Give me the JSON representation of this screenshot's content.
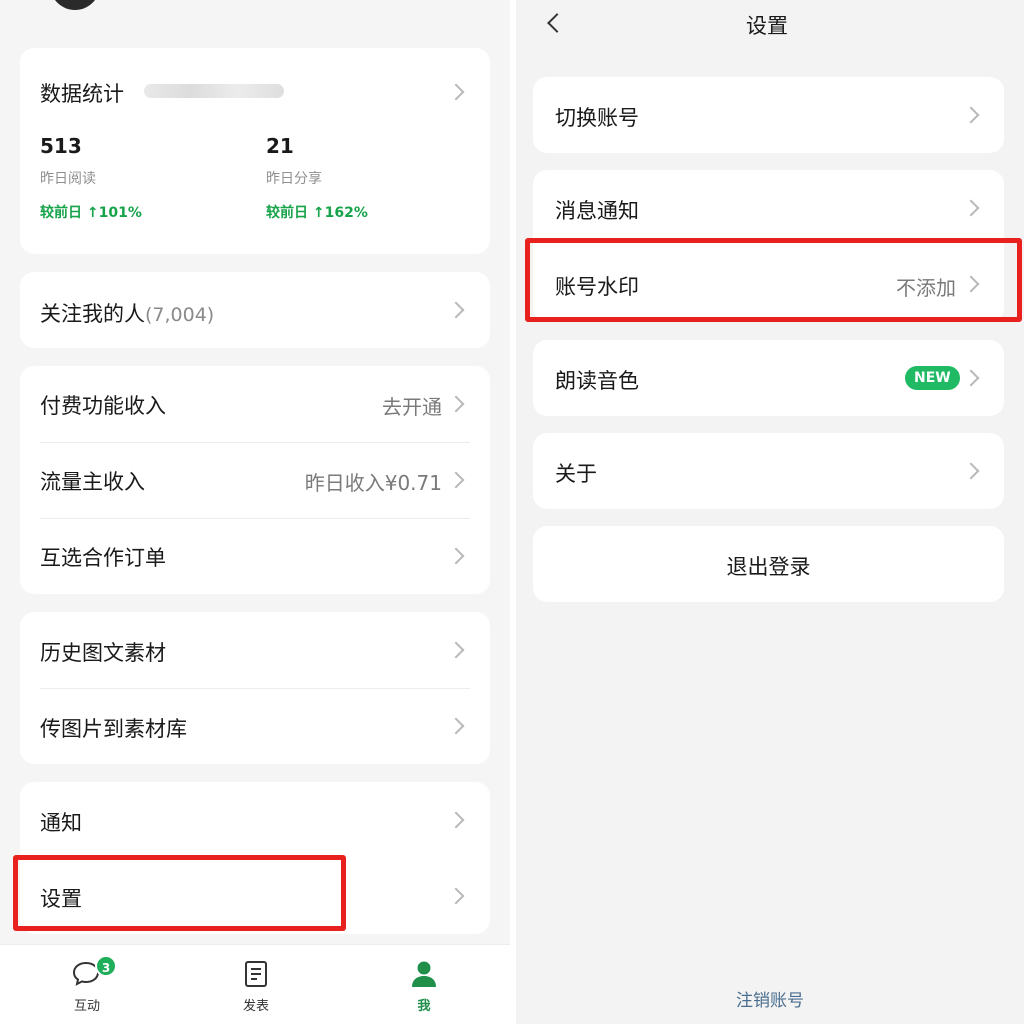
{
  "left": {
    "stats_card": {
      "title": "数据统计",
      "items": [
        {
          "value": "513",
          "label": "昨日阅读",
          "delta": "较前日 ↑101%"
        },
        {
          "value": "21",
          "label": "昨日分享",
          "delta": "较前日 ↑162%"
        }
      ]
    },
    "followers": {
      "label": "关注我的人",
      "count": "(7,004)"
    },
    "income_group": [
      {
        "label": "付费功能收入",
        "value": "去开通"
      },
      {
        "label": "流量主收入",
        "value": "昨日收入¥0.71"
      },
      {
        "label": "互选合作订单",
        "value": ""
      }
    ],
    "material_group": [
      {
        "label": "历史图文素材"
      },
      {
        "label": "传图片到素材库"
      }
    ],
    "other_group": [
      {
        "label": "通知"
      },
      {
        "label": "设置"
      }
    ],
    "tabs": [
      {
        "label": "互动",
        "icon": "chat-icon",
        "badge": "3"
      },
      {
        "label": "发表",
        "icon": "document-icon"
      },
      {
        "label": "我",
        "icon": "person-icon"
      }
    ]
  },
  "right": {
    "title": "设置",
    "items": [
      {
        "label": "切换账号",
        "value": ""
      },
      {
        "label": "消息通知",
        "value": ""
      },
      {
        "label": "账号水印",
        "value": "不添加"
      },
      {
        "label": "朗读音色",
        "badge": "NEW"
      },
      {
        "label": "关于",
        "value": ""
      }
    ],
    "logout": "退出登录",
    "cancel_account": "注销账号"
  },
  "colors": {
    "accent_green": "#1fae5a",
    "highlight_red": "#e8211f",
    "link_blue": "#4a6e8f"
  }
}
